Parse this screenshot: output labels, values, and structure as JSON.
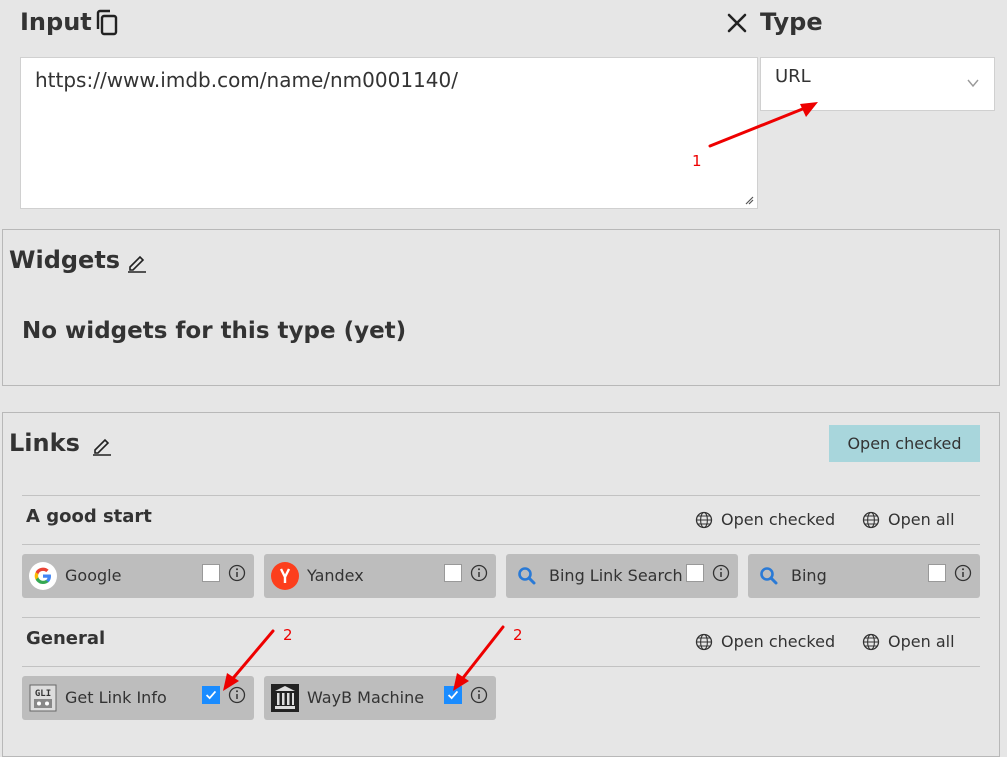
{
  "input": {
    "title": "Input",
    "value": "https://www.imdb.com/name/nm0001140/"
  },
  "type": {
    "title": "Type",
    "selected": "URL"
  },
  "annotations": {
    "a1": "1",
    "a2": "2",
    "a3": "2"
  },
  "widgets": {
    "title": "Widgets",
    "empty_message": "No widgets for this type (yet)"
  },
  "links": {
    "title": "Links",
    "open_checked_label": "Open checked",
    "groups": [
      {
        "title": "A good start",
        "open_checked": "Open checked",
        "open_all": "Open all",
        "items": [
          {
            "label": "Google",
            "icon": "google-icon",
            "checked": false
          },
          {
            "label": "Yandex",
            "icon": "yandex-icon",
            "checked": false
          },
          {
            "label": "Bing Link Search",
            "icon": "magnifier-icon",
            "checked": false
          },
          {
            "label": "Bing",
            "icon": "magnifier-icon",
            "checked": false
          }
        ]
      },
      {
        "title": "General",
        "open_checked": "Open checked",
        "open_all": "Open all",
        "items": [
          {
            "label": "Get Link Info",
            "icon": "gli-icon",
            "checked": true
          },
          {
            "label": "WayB Machine",
            "icon": "archive-icon",
            "checked": true
          }
        ]
      }
    ]
  },
  "colors": {
    "accent_button": "#a8d6dc",
    "checkbox_on": "#1a8cff",
    "annotation": "#e00000"
  }
}
